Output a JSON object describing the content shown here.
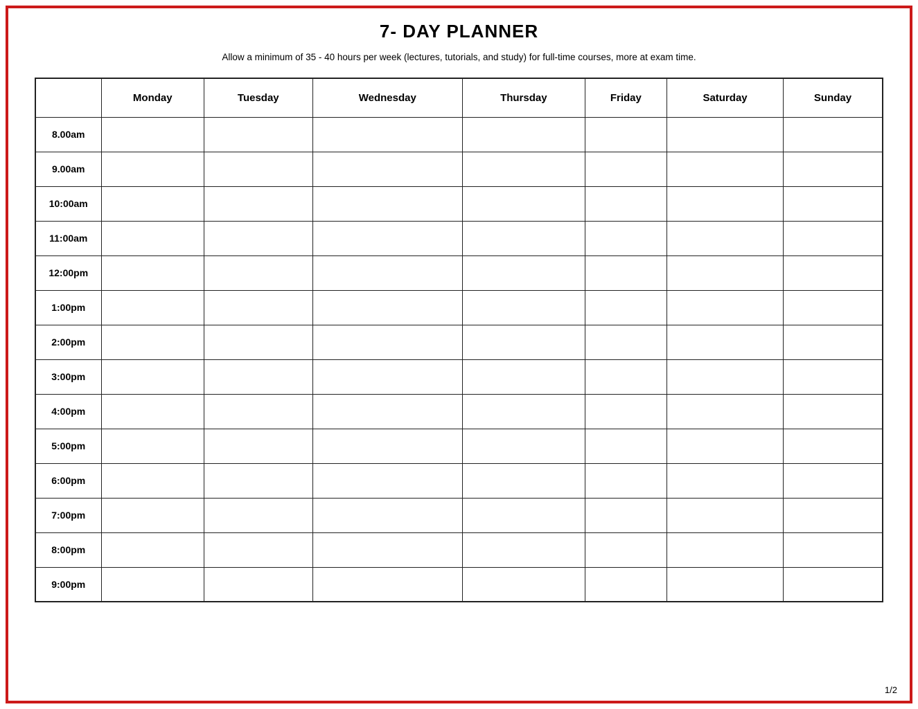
{
  "page": {
    "border_color": "#cc1a1a",
    "title": "7- DAY PLANNER",
    "subtitle": "Allow a minimum of 35 - 40 hours per week (lectures, tutorials, and study) for full-time courses, more at exam time.",
    "page_number": "1/2"
  },
  "table": {
    "days": [
      "Monday",
      "Tuesday",
      "Wednesday",
      "Thursday",
      "Friday",
      "Saturday",
      "Sunday"
    ],
    "time_slots": [
      "8.00am",
      "9.00am",
      "10:00am",
      "11:00am",
      "12:00pm",
      "1:00pm",
      "2:00pm",
      "3:00pm",
      "4:00pm",
      "5:00pm",
      "6:00pm",
      "7:00pm",
      "8:00pm",
      "9:00pm"
    ]
  }
}
